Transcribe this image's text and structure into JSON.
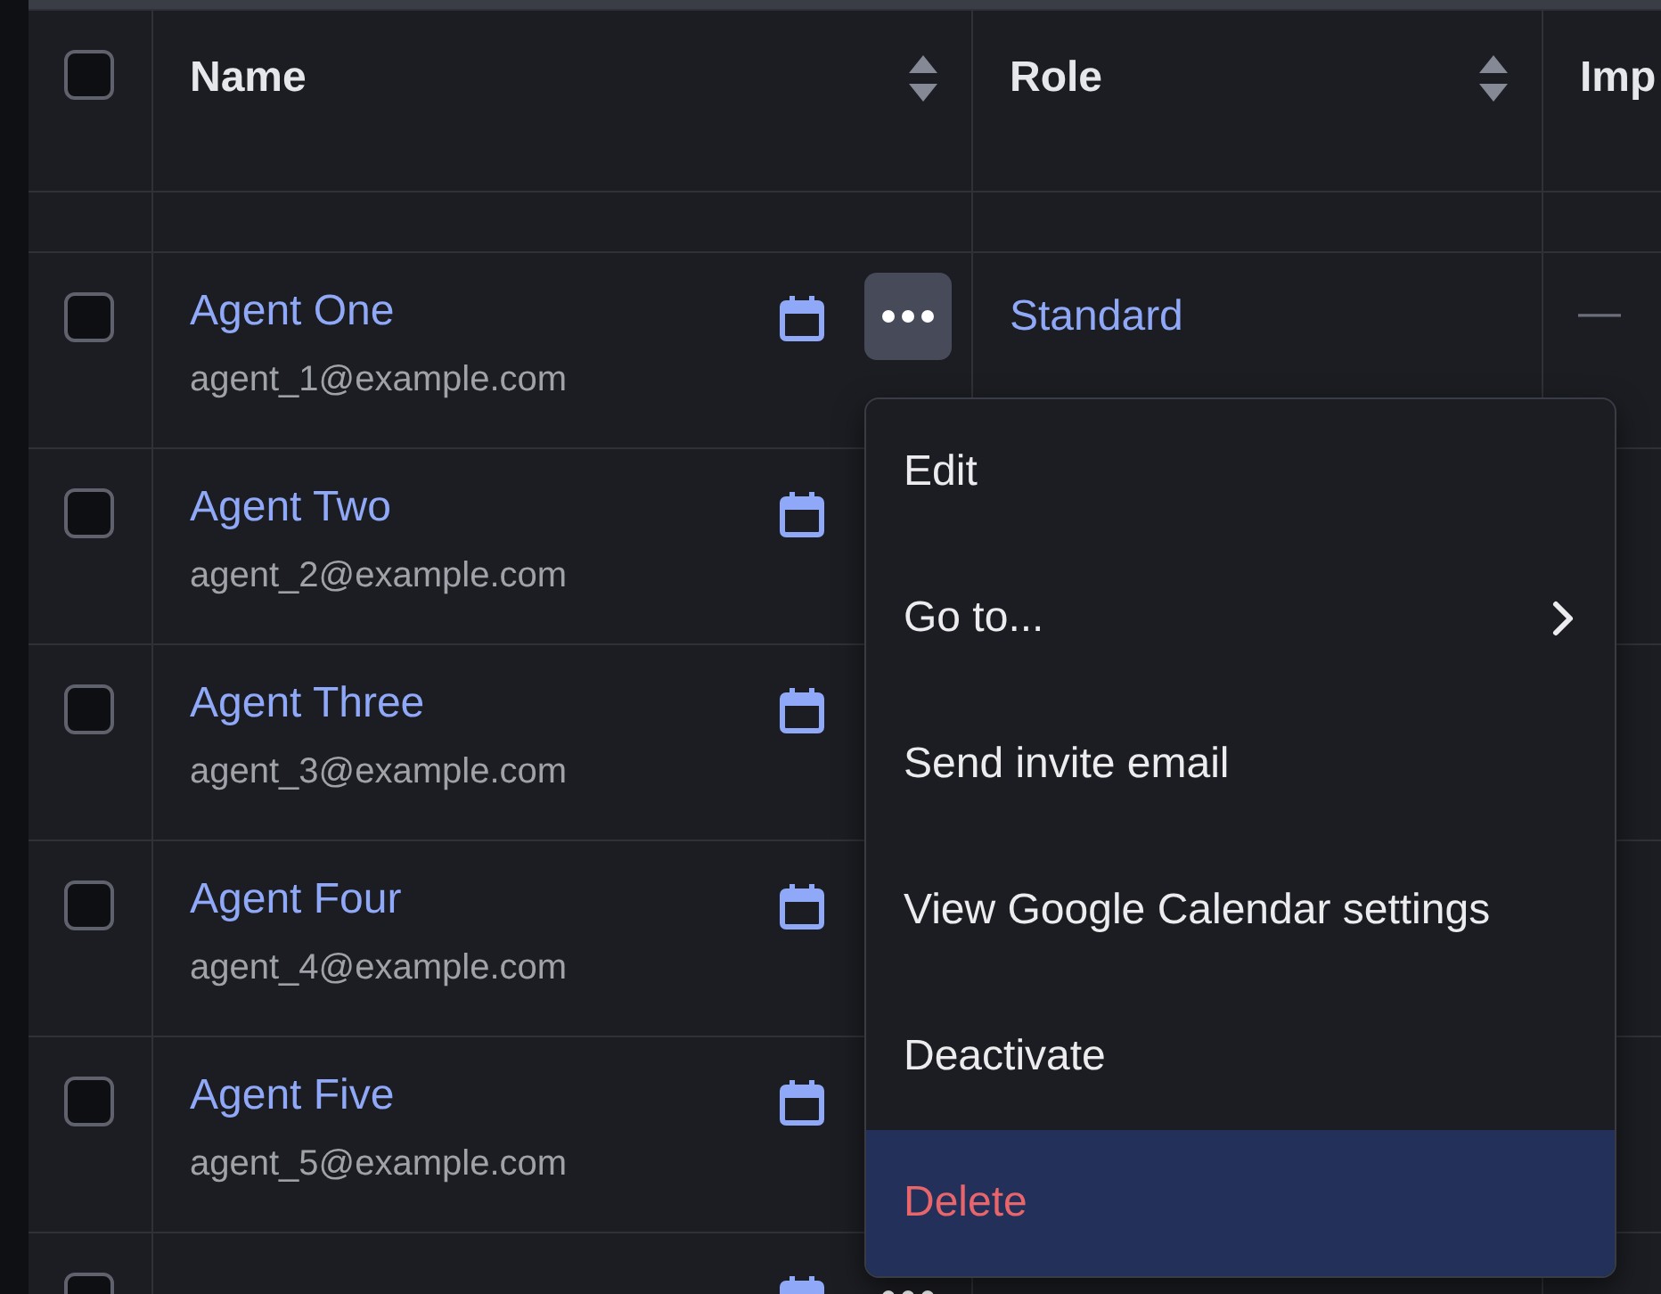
{
  "table": {
    "select_all": {
      "checked": false
    },
    "columns": [
      {
        "label": "Name",
        "sortable": true
      },
      {
        "label": "Role",
        "sortable": true
      },
      {
        "label": "Imp"
      }
    ],
    "rows": [
      {
        "name": "Agent One",
        "email": "agent_1@example.com",
        "checked": false,
        "actions": {
          "open": true
        },
        "role": "Standard",
        "column_3": "—"
      },
      {
        "name": "Agent Two",
        "email": "agent_2@example.com",
        "checked": false
      },
      {
        "name": "Agent Three",
        "email": "agent_3@example.com",
        "checked": false
      },
      {
        "name": "Agent Four",
        "email": "agent_4@example.com",
        "checked": false
      },
      {
        "name": "Agent Five",
        "email": "agent_5@example.com",
        "checked": false
      },
      {
        "checked": false,
        "actions": {
          "open": false
        }
      }
    ]
  },
  "row_menu": {
    "items": [
      {
        "label": "Edit",
        "kind": "item",
        "selected": false
      },
      {
        "label": "Go to...",
        "kind": "submenu",
        "selected": false
      },
      {
        "label": "Send invite email",
        "kind": "item",
        "selected": false
      },
      {
        "label": "View Google Calendar settings",
        "kind": "item",
        "selected": false
      },
      {
        "label": "Deactivate",
        "kind": "item",
        "selected": false
      },
      {
        "label": "Delete",
        "kind": "danger",
        "selected": true
      }
    ]
  }
}
